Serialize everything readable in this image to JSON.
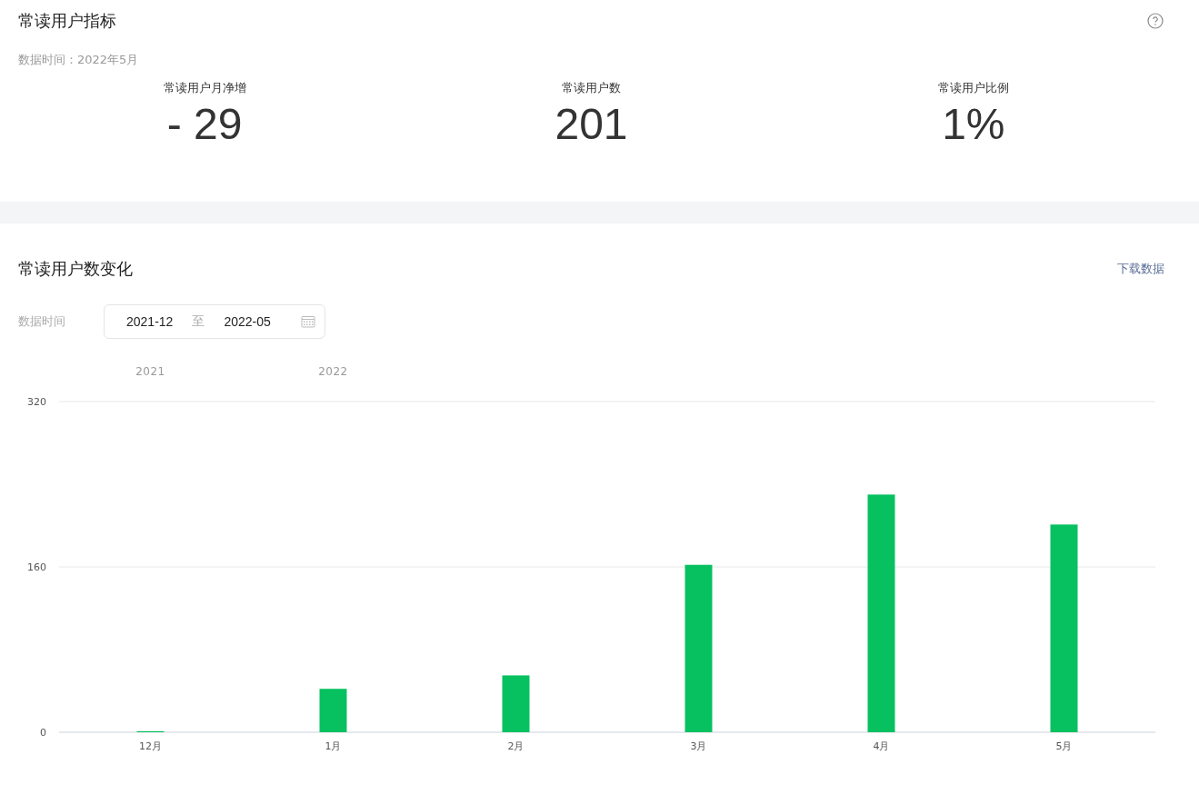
{
  "indicators": {
    "title": "常读用户指标",
    "data_time": "数据时间：2022年5月",
    "metrics": [
      {
        "label": "常读用户月净增",
        "value": "- 29"
      },
      {
        "label": "常读用户数",
        "value": "201"
      },
      {
        "label": "常读用户比例",
        "value": "1%"
      }
    ]
  },
  "trend": {
    "title": "常读用户数变化",
    "download_link": "下载数据",
    "filter_label": "数据时间",
    "date_range": {
      "start": "2021-12",
      "separator": "至",
      "end": "2022-05"
    },
    "year_labels": [
      "2021",
      "2022"
    ],
    "chart_data": {
      "type": "bar",
      "categories": [
        "12月",
        "1月",
        "2月",
        "3月",
        "4月",
        "5月"
      ],
      "series": [
        {
          "color": "#07c160",
          "values": [
            1,
            42,
            55,
            162,
            230,
            201
          ]
        }
      ],
      "ylim": [
        0,
        320
      ],
      "yticks": [
        0,
        160,
        320
      ]
    }
  }
}
